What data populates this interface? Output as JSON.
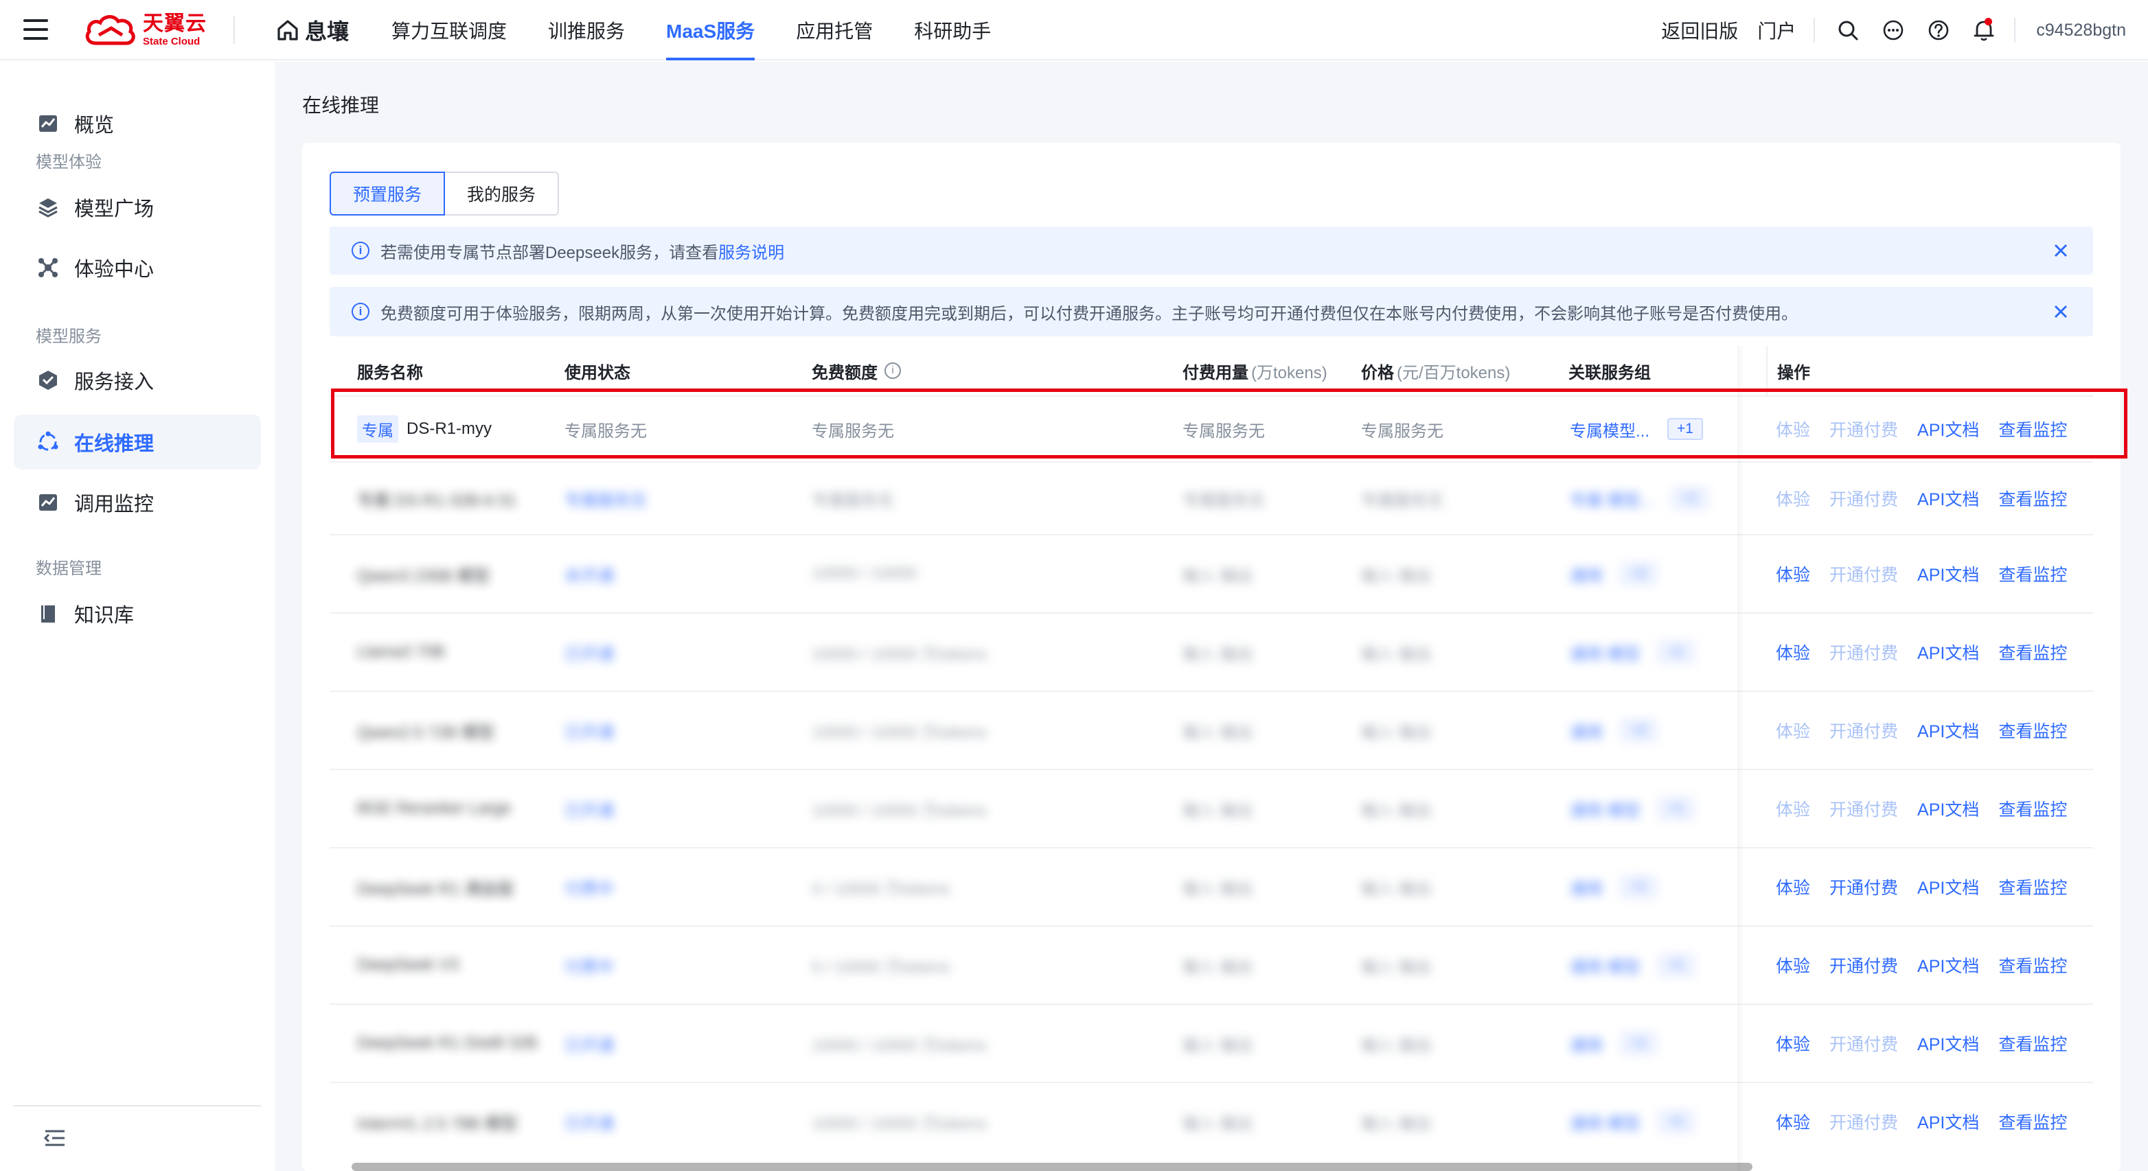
{
  "header": {
    "logo_cn": "天翼云",
    "logo_en": "State Cloud",
    "home_label": "息壤",
    "nav": [
      {
        "label": "算力互联调度",
        "active": false
      },
      {
        "label": "训推服务",
        "active": false
      },
      {
        "label": "MaaS服务",
        "active": true
      },
      {
        "label": "应用托管",
        "active": false
      },
      {
        "label": "科研助手",
        "active": false
      }
    ],
    "back_old": "返回旧版",
    "portal": "门户",
    "user": "c94528bgtn"
  },
  "sidebar": {
    "overview": "概览",
    "group_experience": "模型体验",
    "model_square": "模型广场",
    "experience_center": "体验中心",
    "group_service": "模型服务",
    "service_access": "服务接入",
    "online_inference": "在线推理",
    "call_monitor": "调用监控",
    "group_data": "数据管理",
    "knowledge_base": "知识库"
  },
  "page": {
    "title": "在线推理",
    "tabs": [
      "预置服务",
      "我的服务"
    ],
    "alert1_text": "若需使用专属节点部署Deepseek服务，请查看",
    "alert1_link": "服务说明",
    "alert2_text": "免费额度可用于体验服务，限期两周，从第一次使用开始计算。免费额度用完或到期后，可以付费开通服务。主子账号均可开通付费但仅在本账号内付费使用，不会影响其他子账号是否付费使用。"
  },
  "table": {
    "headers": {
      "name": "服务名称",
      "status": "使用状态",
      "free": "免费额度",
      "paid": "付费用量",
      "paid_unit": "(万tokens)",
      "price": "价格",
      "price_unit": "(元/百万tokens)",
      "group": "关联服务组",
      "ops": "操作"
    },
    "first_row": {
      "tag": "专属",
      "name": "DS-R1-myy",
      "status": "专属服务无",
      "free": "专属服务无",
      "paid": "专属服务无",
      "price": "专属服务无",
      "group": "专属模型...",
      "badge": "+1"
    },
    "ops": {
      "try": "体验",
      "pay": "开通付费",
      "api": "API文档",
      "monitor": "查看监控"
    },
    "blurred_rows": [
      {
        "name": "专属 DS-R1-32B-tt 01",
        "status": "专属服务无",
        "free": "专属服务无",
        "paid": "专属服务无",
        "price": "专属服务无",
        "group": "专属 模型...",
        "badge": "+1",
        "try_enabled": false,
        "pay_enabled": false
      },
      {
        "name": "Qwen3 235B 模型",
        "status": "未开通",
        "free": "10000 / 10000",
        "paid": "输入 输出",
        "price": "输入 输出",
        "group": "通用",
        "badge": "+2",
        "try_enabled": true,
        "pay_enabled": false
      },
      {
        "name": "Llama3 70B",
        "status": "已开通",
        "free": "10000 / 10000 万tokens",
        "paid": "输入 输出",
        "price": "输入 输出",
        "group": "通用 模型",
        "badge": "+1",
        "try_enabled": true,
        "pay_enabled": false
      },
      {
        "name": "Qwen2.5 72B 模型",
        "status": "已开通",
        "free": "10000 / 10000 万tokens",
        "paid": "输入 输出",
        "price": "输入 输出",
        "group": "通用",
        "badge": "+2",
        "try_enabled": false,
        "pay_enabled": false
      },
      {
        "name": "BGE Reranker Large",
        "status": "已开通",
        "free": "10000 / 10000 万tokens",
        "paid": "输入 输出",
        "price": "输入 输出",
        "group": "通用 模型",
        "badge": "+1",
        "try_enabled": false,
        "pay_enabled": false
      },
      {
        "name": "DeepSeek R1 满血版",
        "status": "付费中",
        "free": "0 / 10000 万tokens",
        "paid": "输入 输出",
        "price": "输入 输出",
        "group": "通用",
        "badge": "+1",
        "try_enabled": true,
        "pay_enabled": true
      },
      {
        "name": "DeepSeek V3",
        "status": "付费中",
        "free": "0 / 10000 万tokens",
        "paid": "输入 输出",
        "price": "输入 输出",
        "group": "通用 模型",
        "badge": "+1",
        "try_enabled": true,
        "pay_enabled": true
      },
      {
        "name": "DeepSeek R1 Distill 32B",
        "status": "已开通",
        "free": "10000 / 10000 万tokens",
        "paid": "输入 输出",
        "price": "输入 输出",
        "group": "通用",
        "badge": "+1",
        "try_enabled": true,
        "pay_enabled": false
      },
      {
        "name": "InternVL 2.5 78B 模型",
        "status": "已开通",
        "free": "10000 / 10000 万tokens",
        "paid": "输入 输出",
        "price": "输入 输出",
        "group": "通用 模型",
        "badge": "+1",
        "try_enabled": true,
        "pay_enabled": false
      }
    ]
  }
}
